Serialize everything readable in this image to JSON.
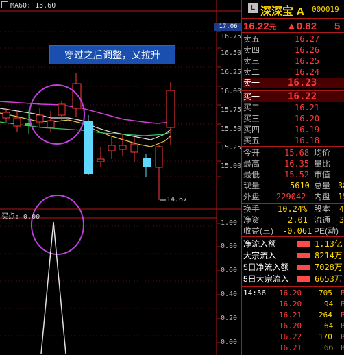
{
  "colors": {
    "up": "#ff3b3b",
    "down": "#34d058",
    "accent": "#ffd700",
    "ma_white": "#e0e0e0",
    "ma_yellow": "#e6c84b",
    "ma_magenta": "#d040d0",
    "ma_green": "#3cc060",
    "circle": "#c040e0",
    "annotation_bg": "#1a4fb0"
  },
  "top_chart": {
    "ma_label": "MA60: 15.60",
    "ma_icon": "checkbox-icon",
    "annotation": "穿过之后调整，又拉升",
    "low_marker": "14.67",
    "high_marker": "17.06",
    "axis_labels": [
      "16.75",
      "16.50",
      "16.25",
      "16.00",
      "15.75",
      "15.50",
      "15.25",
      "15.00"
    ]
  },
  "bottom_chart": {
    "label": "买点: 0.00",
    "axis_labels": [
      "1.00",
      "0.80",
      "0.60",
      "0.40",
      "0.20",
      "0.00"
    ]
  },
  "quote": {
    "logo": "L",
    "name": "深深宝 A",
    "code": "000019",
    "price": "16.22",
    "price_unit": "元",
    "change": "▲0.82",
    "change_pct": "5",
    "asks": [
      {
        "label": "卖五",
        "price": "16.27"
      },
      {
        "label": "卖四",
        "price": "16.26"
      },
      {
        "label": "卖三",
        "price": "16.25"
      },
      {
        "label": "卖二",
        "price": "16.24"
      },
      {
        "label": "卖一",
        "price": "16.23"
      }
    ],
    "bids": [
      {
        "label": "买一",
        "price": "16.22"
      },
      {
        "label": "买二",
        "price": "16.21"
      },
      {
        "label": "买三",
        "price": "16.20"
      },
      {
        "label": "买四",
        "price": "16.19"
      },
      {
        "label": "买五",
        "price": "16.18"
      }
    ],
    "stats": [
      {
        "l1": "今开",
        "v1": "15.68",
        "l2": "均价",
        "v2": ""
      },
      {
        "l1": "最高",
        "v1": "16.35",
        "l2": "量比",
        "v2": ""
      },
      {
        "l1": "最低",
        "v1": "15.52",
        "l2": "市值",
        "v2": ""
      },
      {
        "l1": "现量",
        "v1": "5610",
        "l2": "总量",
        "v2": "38"
      },
      {
        "l1": "外盘",
        "v1": "229042",
        "l2": "内盘",
        "v2": "15"
      }
    ],
    "stats2": [
      {
        "l1": "换手",
        "v1": "10.24%",
        "l2": "股本",
        "v2": "4"
      },
      {
        "l1": "净资",
        "v1": "2.01",
        "l2": "流通",
        "v2": "3"
      },
      {
        "l1": "收益(三)",
        "v1": "-0.061",
        "l2": "PE(动)",
        "v2": ""
      }
    ],
    "flows": [
      {
        "label": "净流入额",
        "value": "1.13亿",
        "fill": 0.2
      },
      {
        "label": "大宗流入",
        "value": "8214万",
        "fill": 0.2
      },
      {
        "label": "5日净流入额",
        "value": "7028万",
        "fill": 0.2
      },
      {
        "label": "5日大宗流入",
        "value": "6653万",
        "fill": 0.2
      }
    ],
    "trades": [
      {
        "time": "14:56",
        "price": "16.20",
        "vol": "705",
        "tail": "B"
      },
      {
        "time": "",
        "price": "16.20",
        "vol": "94",
        "tail": "B"
      },
      {
        "time": "",
        "price": "16.21",
        "vol": "264",
        "tail": "B"
      },
      {
        "time": "",
        "price": "16.20",
        "vol": "64",
        "tail": "B"
      },
      {
        "time": "",
        "price": "16.22",
        "vol": "170",
        "tail": "B"
      },
      {
        "time": "",
        "price": "16.21",
        "vol": "66",
        "tail": "B"
      }
    ]
  }
}
